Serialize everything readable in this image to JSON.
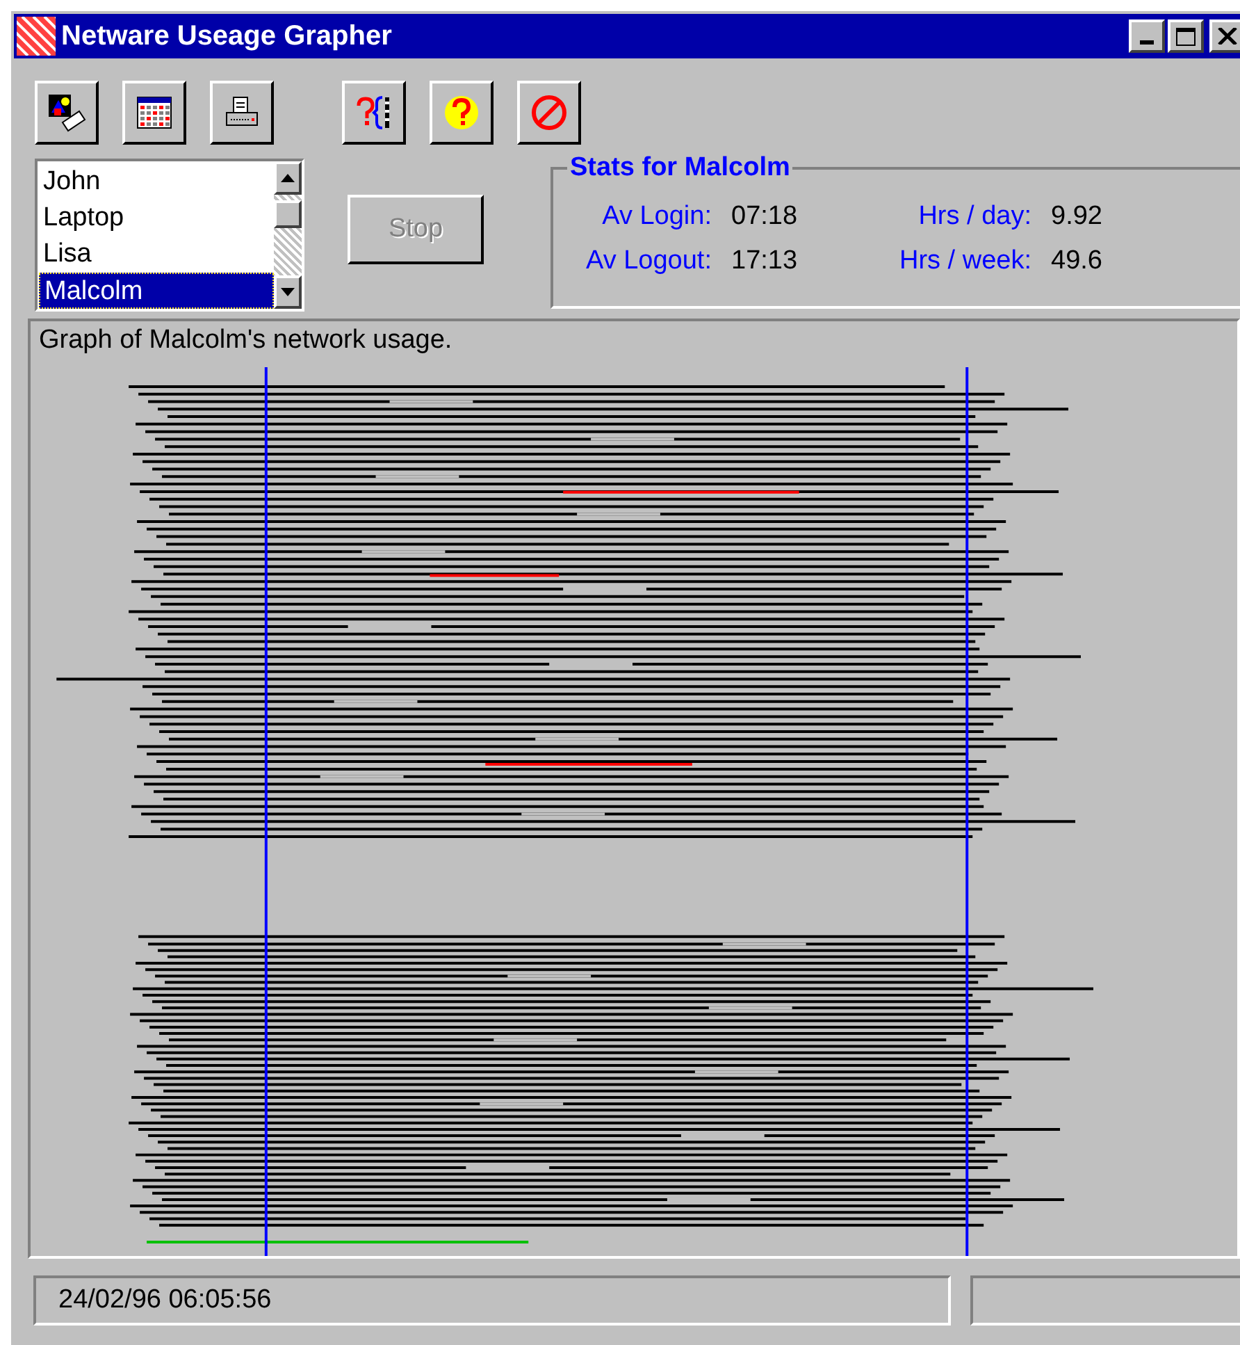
{
  "window": {
    "title": "Netware Useage Grapher"
  },
  "toolbar": [
    {
      "kind": "users"
    },
    {
      "kind": "calendar"
    },
    {
      "kind": "print"
    },
    {
      "kind": "gap"
    },
    {
      "kind": "query"
    },
    {
      "kind": "help"
    },
    {
      "kind": "stop"
    }
  ],
  "user_list": [
    {
      "label": "John",
      "selected": false
    },
    {
      "label": "Laptop",
      "selected": false
    },
    {
      "label": "Lisa",
      "selected": false
    },
    {
      "label": "Malcolm",
      "selected": true
    }
  ],
  "stop_button": {
    "label": "Stop",
    "disabled": true
  },
  "stats": {
    "title": "Stats for Malcolm",
    "items": [
      {
        "label": "Av Login:",
        "value": "07:18"
      },
      {
        "label": "Hrs / day:",
        "value": "9.92"
      },
      {
        "label": "Av Logout:",
        "value": "17:13"
      },
      {
        "label": "Hrs / week:",
        "value": "49.6"
      }
    ]
  },
  "graph": {
    "caption": "Graph of Malcolm's network usage."
  },
  "status_bar": {
    "text": "24/02/96 06:05:56"
  }
}
